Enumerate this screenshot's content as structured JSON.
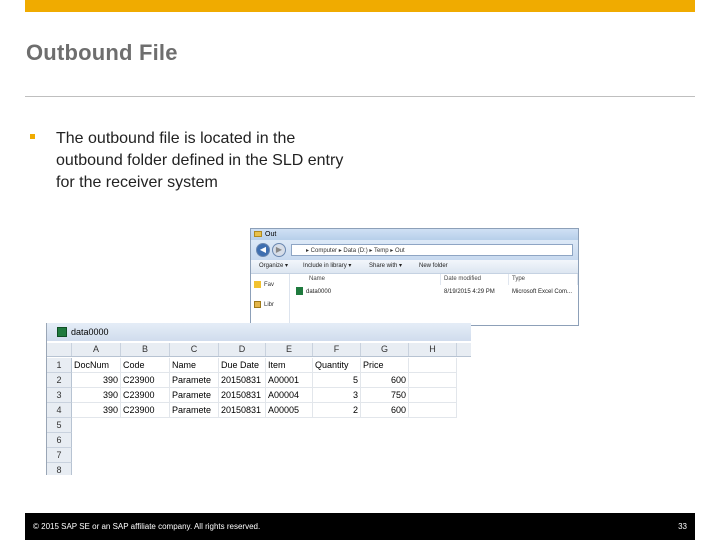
{
  "slide": {
    "title": "Outbound File",
    "bullet": "The outbound file is located in the outbound folder defined in the SLD entry for the receiver system"
  },
  "explorer": {
    "window_title": "Out",
    "address": "▸ Computer ▸ Data (D:) ▸ Temp ▸ Out",
    "toolbar": [
      "Organize ▾",
      "Include in library ▾",
      "Share with ▾",
      "New folder"
    ],
    "nav_items": [
      "Fav",
      "Libr"
    ],
    "columns": [
      "Name",
      "Date modified",
      "Type"
    ],
    "file": {
      "name": "data0000",
      "date": "8/19/2015 4:29 PM",
      "type": "Microsoft Excel Com..."
    }
  },
  "excel": {
    "window_title": "data0000",
    "columns": [
      "A",
      "B",
      "C",
      "D",
      "E",
      "F",
      "G",
      "H"
    ],
    "row_numbers": [
      "1",
      "2",
      "3",
      "4",
      "5",
      "6",
      "7",
      "8"
    ],
    "rows": [
      [
        "DocNum",
        "Code",
        "Name",
        "Due Date",
        "Item",
        "Quantity",
        "Price",
        ""
      ],
      [
        "390",
        "C23900",
        "Paramete",
        "20150831",
        "A00001",
        "5",
        "600",
        ""
      ],
      [
        "390",
        "C23900",
        "Paramete",
        "20150831",
        "A00004",
        "3",
        "750",
        ""
      ],
      [
        "390",
        "C23900",
        "Paramete",
        "20150831",
        "A00005",
        "2",
        "600",
        ""
      ]
    ]
  },
  "footer": {
    "copyright": "© 2015 SAP SE or an SAP affiliate company. All rights reserved.",
    "page_number": "33"
  },
  "colors": {
    "accent": "#f0ab00",
    "footer_bg": "#000000",
    "title": "#6e6e6e"
  }
}
